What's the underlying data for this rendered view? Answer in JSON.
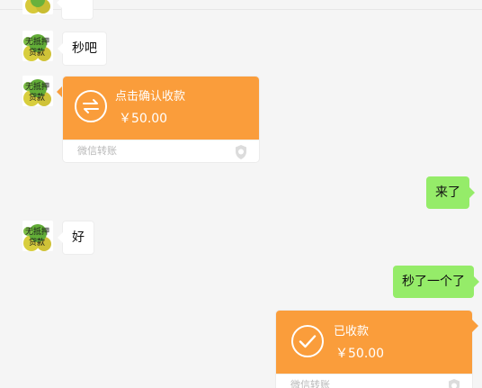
{
  "messages": [
    {
      "type": "incoming_text",
      "text": "秒吧"
    },
    {
      "type": "incoming_transfer",
      "title": "点击确认收款",
      "amount": "￥50.00",
      "label": "微信转账"
    },
    {
      "type": "outgoing_text",
      "text": "来了"
    },
    {
      "type": "incoming_text",
      "text": "好"
    },
    {
      "type": "outgoing_text",
      "text": "秒了一个了"
    },
    {
      "type": "outgoing_transfer",
      "title": "已收款",
      "amount": "￥50.00",
      "label": "微信转账"
    }
  ],
  "avatar": {
    "text_line1": "无抵押",
    "text_line2": "贷款"
  },
  "colors": {
    "background": "#f5f5f5",
    "incoming_bubble": "#ffffff",
    "outgoing_bubble": "#95ec69",
    "transfer": "#fa9d3b"
  },
  "icons": {
    "transfer_pending": "exchange-arrows-icon",
    "transfer_received": "checkmark-icon",
    "transfer_badge": "shield-icon"
  }
}
